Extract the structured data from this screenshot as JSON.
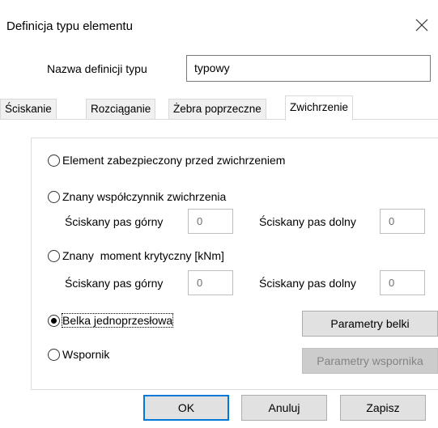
{
  "dialog": {
    "title": "Definicja typu elementu",
    "close_icon": "close-icon"
  },
  "name_field": {
    "label": "Nazwa definicji typu",
    "value": "typowy"
  },
  "tabs": [
    {
      "label": "Ściskanie",
      "active": false
    },
    {
      "label": "Rozciąganie",
      "active": false
    },
    {
      "label": "Żebra poprzeczne",
      "active": false
    },
    {
      "label": "Zwichrzenie",
      "active": true
    }
  ],
  "options": {
    "protected": {
      "label": "Element zabezpieczony przed zwichrzeniem",
      "checked": false
    },
    "known_coefficient": {
      "label": "Znany współczynnik zwichrzenia",
      "checked": false,
      "upper_label": "Ściskany pas górny",
      "upper_value": "0",
      "lower_label": "Ściskany pas dolny",
      "lower_value": "0"
    },
    "known_moment": {
      "label": "Znany  moment krytyczny [kNm]",
      "checked": false,
      "upper_label": "Ściskany pas górny",
      "upper_value": "0",
      "lower_label": "Ściskany pas dolny",
      "lower_value": "0"
    },
    "simple_beam": {
      "label": "Belka jednoprzesłowa",
      "checked": true,
      "button": "Parametry belki"
    },
    "cantilever": {
      "label": "Wspornik",
      "checked": false,
      "button": "Parametry wspornika"
    }
  },
  "footer": {
    "ok": "OK",
    "cancel": "Anuluj",
    "save": "Zapisz"
  }
}
